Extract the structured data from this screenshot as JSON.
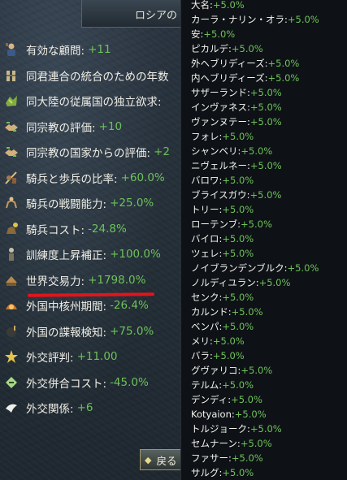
{
  "panel": {
    "title": "ロシアの",
    "back_label": "戻る",
    "modifiers": [
      {
        "label": "有効な顧問:",
        "value": "+11",
        "icon": "advisor-icon"
      },
      {
        "label": "同君連合の統合のための年数",
        "value": "",
        "icon": "union-icon"
      },
      {
        "label": "同大陸の従属国の独立欲求:",
        "value": "",
        "icon": "map-icon"
      },
      {
        "label": "同宗教の評価:",
        "value": "+10",
        "icon": "handshake-icon"
      },
      {
        "label": "同宗教の国家からの評価:",
        "value": "+2",
        "icon": "handshake-icon"
      },
      {
        "label": "騎兵と歩兵の比率:",
        "value": "+60.0%",
        "icon": "cavalry-infantry-icon"
      },
      {
        "label": "騎兵の戦闘能力:",
        "value": "+25.0%",
        "icon": "cavalry-icon"
      },
      {
        "label": "騎兵コスト:",
        "value": "-24.8%",
        "icon": "cavalry-cost-icon"
      },
      {
        "label": "訓練度上昇補正:",
        "value": "+100.0%",
        "icon": "drill-icon"
      },
      {
        "label": "世界交易力:",
        "value": "+1798.0%",
        "icon": "trade-icon"
      },
      {
        "label": "外国中核州期間:",
        "value": "-26.4%",
        "icon": "core-icon"
      },
      {
        "label": "外国の諜報検知:",
        "value": "+75.0%",
        "icon": "spy-icon"
      },
      {
        "label": "外交評判:",
        "value": "+11.00",
        "icon": "reputation-icon"
      },
      {
        "label": "外交併合コスト:",
        "value": "-45.0%",
        "icon": "annex-icon"
      },
      {
        "label": "外交関係:",
        "value": "+6",
        "icon": "dove-icon"
      }
    ]
  },
  "tooltip": {
    "entries": [
      {
        "name": "大名:",
        "value": "+5.0%"
      },
      {
        "name": "カーラ・ナリン・オラ:",
        "value": "+5.0%"
      },
      {
        "name": "安:",
        "value": "+5.0%"
      },
      {
        "name": "ピカルデ:",
        "value": "+5.0%"
      },
      {
        "name": "外ヘブリディーズ:",
        "value": "+5.0%"
      },
      {
        "name": "内ヘブリディーズ:",
        "value": "+5.0%"
      },
      {
        "name": "サザーランド:",
        "value": "+5.0%"
      },
      {
        "name": "インヴァネス:",
        "value": "+5.0%"
      },
      {
        "name": "ヴァンヌテー:",
        "value": "+5.0%"
      },
      {
        "name": "フォレ:",
        "value": "+5.0%"
      },
      {
        "name": "シャンベリ:",
        "value": "+5.0%"
      },
      {
        "name": "ニヴェルネー:",
        "value": "+5.0%"
      },
      {
        "name": "バロワ:",
        "value": "+5.0%"
      },
      {
        "name": "ブライスガウ:",
        "value": "+5.0%"
      },
      {
        "name": "トリー:",
        "value": "+5.0%"
      },
      {
        "name": "ローテンブ:",
        "value": "+5.0%"
      },
      {
        "name": "バイロ:",
        "value": "+5.0%"
      },
      {
        "name": "ツェレ:",
        "value": "+5.0%"
      },
      {
        "name": "ノイブランデンブルク:",
        "value": "+5.0%"
      },
      {
        "name": "ノルディユラン:",
        "value": "+5.0%"
      },
      {
        "name": "センク:",
        "value": "+5.0%"
      },
      {
        "name": "カルンド:",
        "value": "+5.0%"
      },
      {
        "name": "ベンパ:",
        "value": "+5.0%"
      },
      {
        "name": "メリ:",
        "value": "+5.0%"
      },
      {
        "name": "バラ:",
        "value": "+5.0%"
      },
      {
        "name": "グヴァリコ:",
        "value": "+5.0%"
      },
      {
        "name": "テルム:",
        "value": "+5.0%"
      },
      {
        "name": "デンディ:",
        "value": "+5.0%"
      },
      {
        "name": "Kotyaion:",
        "value": "+5.0%"
      },
      {
        "name": "トルジョーク:",
        "value": "+5.0%"
      },
      {
        "name": "セムナーン:",
        "value": "+5.0%"
      },
      {
        "name": "ファサー:",
        "value": "+5.0%"
      },
      {
        "name": "サルグ:",
        "value": "+5.0%"
      }
    ]
  },
  "colors": {
    "positive": "#6ec25a",
    "text": "#f0eee6",
    "highlight_underline": "#e2141c"
  }
}
